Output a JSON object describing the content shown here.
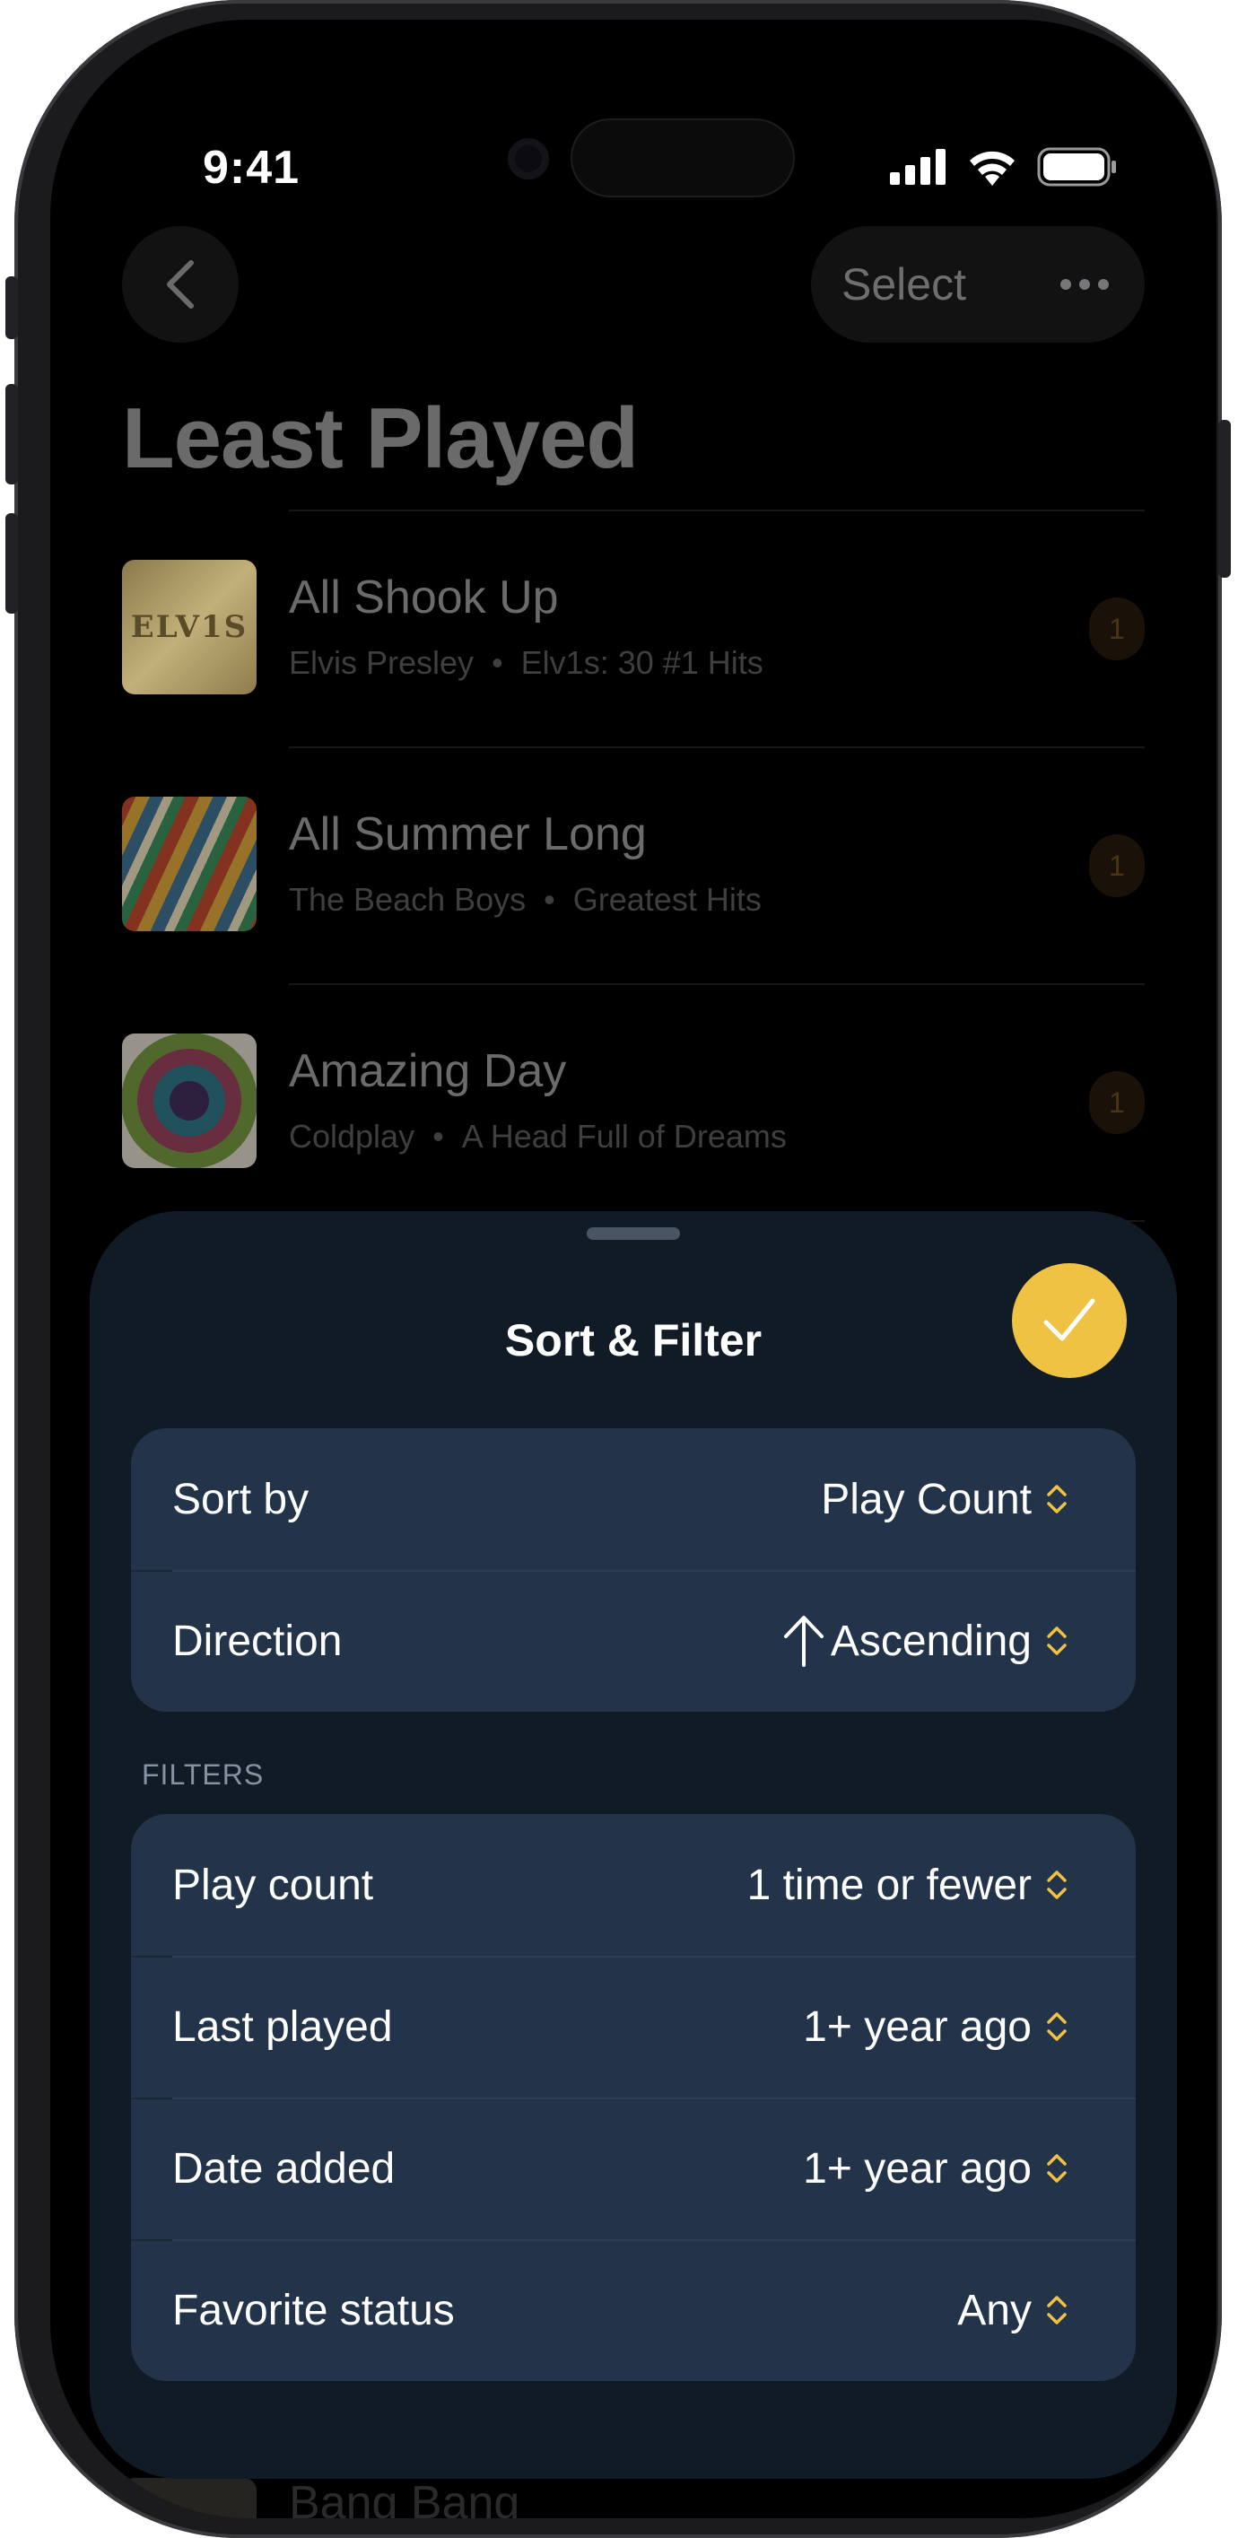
{
  "status_bar": {
    "time": "9:41"
  },
  "header": {
    "back_label": "Back",
    "select_label": "Select"
  },
  "page_title": "Least Played",
  "songs": [
    {
      "title": "All Shook Up",
      "artist": "Elvis Presley",
      "album": "Elv1s: 30 #1 Hits",
      "play_count": "1",
      "art_text": "ELV1S"
    },
    {
      "title": "All Summer Long",
      "artist": "The Beach Boys",
      "album": "Greatest Hits",
      "play_count": "1"
    },
    {
      "title": "Amazing Day",
      "artist": "Coldplay",
      "album": "A Head Full of Dreams",
      "play_count": "1"
    },
    {
      "title": "Bang Bang"
    }
  ],
  "sheet": {
    "title": "Sort & Filter",
    "sort_group": [
      {
        "label": "Sort by",
        "value": "Play Count"
      },
      {
        "label": "Direction",
        "value": "Ascending"
      }
    ],
    "filters_header": "FILTERS",
    "filters": [
      {
        "label": "Play count",
        "value": "1 time or fewer"
      },
      {
        "label": "Last played",
        "value": "1+ year ago"
      },
      {
        "label": "Date added",
        "value": "1+ year ago"
      },
      {
        "label": "Favorite status",
        "value": "Any"
      }
    ]
  },
  "colors": {
    "accent": "#f0c243",
    "sheet_bg": "#111b26",
    "group_bg": "#23344a"
  }
}
